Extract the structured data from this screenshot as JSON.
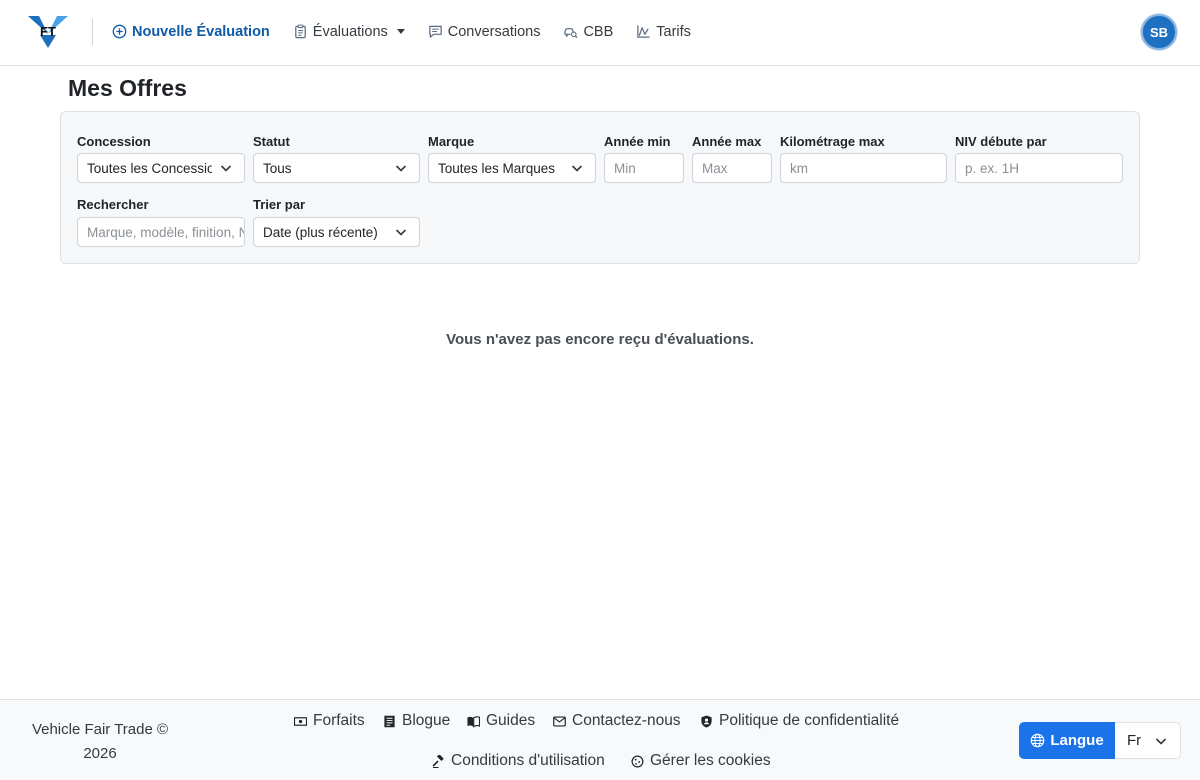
{
  "brand": {
    "logo_text": "FT"
  },
  "nav": {
    "new_eval": "Nouvelle Évaluation",
    "evaluations": "Évaluations",
    "conversations": "Conversations",
    "cbb": "CBB",
    "tarifs": "Tarifs"
  },
  "user": {
    "initials": "SB"
  },
  "page": {
    "title": "Mes Offres"
  },
  "filters": {
    "concession": {
      "label": "Concession",
      "value": "Toutes les Concessions"
    },
    "statut": {
      "label": "Statut",
      "value": "Tous"
    },
    "marque": {
      "label": "Marque",
      "value": "Toutes les Marques"
    },
    "annee_min": {
      "label": "Année min",
      "placeholder": "Min"
    },
    "annee_max": {
      "label": "Année max",
      "placeholder": "Max"
    },
    "km_max": {
      "label": "Kilométrage max",
      "placeholder": "km"
    },
    "niv": {
      "label": "NIV débute par",
      "placeholder": "p. ex. 1H"
    },
    "search": {
      "label": "Rechercher",
      "placeholder": "Marque, modèle, finition, NIV"
    },
    "sort": {
      "label": "Trier par",
      "value": "Date (plus récente)"
    }
  },
  "empty_message": "Vous n'avez pas encore reçu d'évaluations.",
  "footer": {
    "copyright_line1": "Vehicle Fair Trade ©",
    "copyright_line2": "2026",
    "links": {
      "forfaits": "Forfaits",
      "blogue": "Blogue",
      "guides": "Guides",
      "contact": "Contactez-nous",
      "privacy": "Politique de confidentialité",
      "terms": "Conditions d'utilisation",
      "cookies": "Gérer les cookies"
    },
    "language_button": "Langue",
    "language_value": "Fr"
  },
  "colors": {
    "accent": "#0d5ba8",
    "language_button": "#1a73e8",
    "avatar": "#1f6fc2",
    "logo": "#1d6fc0"
  }
}
